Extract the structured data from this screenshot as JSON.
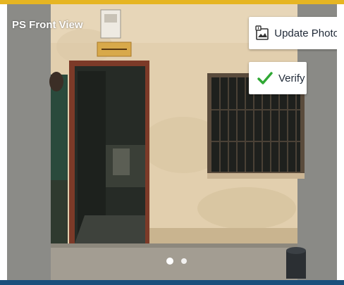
{
  "colors": {
    "accent_top": "#e6b522",
    "accent_bottom": "#1a4f7c",
    "verify_check": "#2fa834"
  },
  "card": {
    "title": "PS Front View",
    "carousel": {
      "total_slides": 2,
      "active_slide": 1
    }
  },
  "actions": {
    "update_photo": {
      "label": "Update Photo",
      "icon": "image-upload-icon"
    },
    "verify": {
      "label": "Verify",
      "icon": "checkmark-icon"
    }
  }
}
